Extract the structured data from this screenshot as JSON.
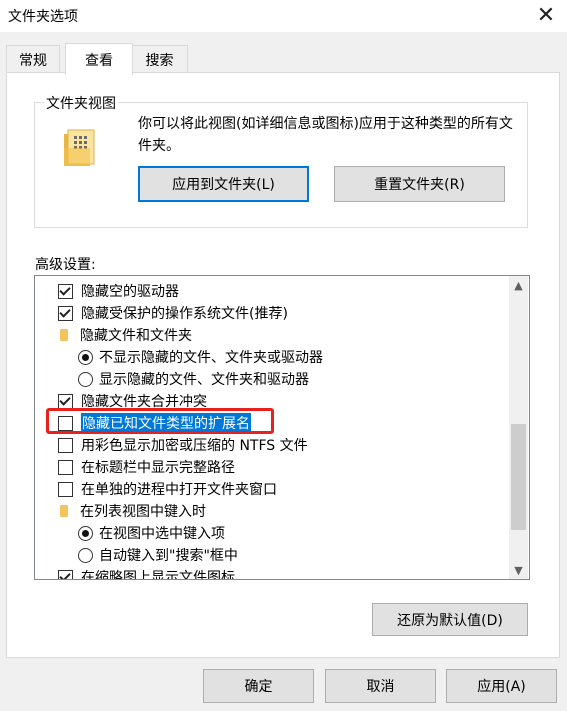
{
  "window": {
    "title": "文件夹选项",
    "close_icon": "✕"
  },
  "tabs": [
    {
      "label": "常规"
    },
    {
      "label": "查看"
    },
    {
      "label": "搜索"
    }
  ],
  "folder_views": {
    "group_title": "文件夹视图",
    "description": "你可以将此视图(如详细信息或图标)应用于这种类型的所有文件夹。",
    "apply_button": "应用到文件夹(L)",
    "reset_button": "重置文件夹(R)"
  },
  "advanced": {
    "label": "高级设置:",
    "items": [
      {
        "type": "checkbox",
        "checked": true,
        "label": "隐藏空的驱动器"
      },
      {
        "type": "checkbox",
        "checked": true,
        "label": "隐藏受保护的操作系统文件(推荐)"
      },
      {
        "type": "folder",
        "label": "隐藏文件和文件夹"
      },
      {
        "type": "radio",
        "checked": true,
        "label": "不显示隐藏的文件、文件夹或驱动器"
      },
      {
        "type": "radio",
        "checked": false,
        "label": "显示隐藏的文件、文件夹和驱动器"
      },
      {
        "type": "checkbox",
        "checked": true,
        "label": "隐藏文件夹合并冲突"
      },
      {
        "type": "checkbox",
        "checked": false,
        "label": "隐藏已知文件类型的扩展名",
        "selected": true
      },
      {
        "type": "checkbox",
        "checked": false,
        "label": "用彩色显示加密或压缩的 NTFS 文件"
      },
      {
        "type": "checkbox",
        "checked": false,
        "label": "在标题栏中显示完整路径"
      },
      {
        "type": "checkbox",
        "checked": false,
        "label": "在单独的进程中打开文件夹窗口"
      },
      {
        "type": "folder",
        "label": "在列表视图中键入时"
      },
      {
        "type": "radio",
        "checked": true,
        "label": "在视图中选中键入项"
      },
      {
        "type": "radio",
        "checked": false,
        "label": "自动键入到\"搜索\"框中"
      },
      {
        "type": "checkbox",
        "checked": true,
        "label": "在缩略图上显示文件图标"
      }
    ],
    "restore_button": "还原为默认值(D)"
  },
  "footer": {
    "ok": "确定",
    "cancel": "取消",
    "apply": "应用(A)"
  },
  "accent": "#0078d7",
  "highlight_color": "#e8211c"
}
